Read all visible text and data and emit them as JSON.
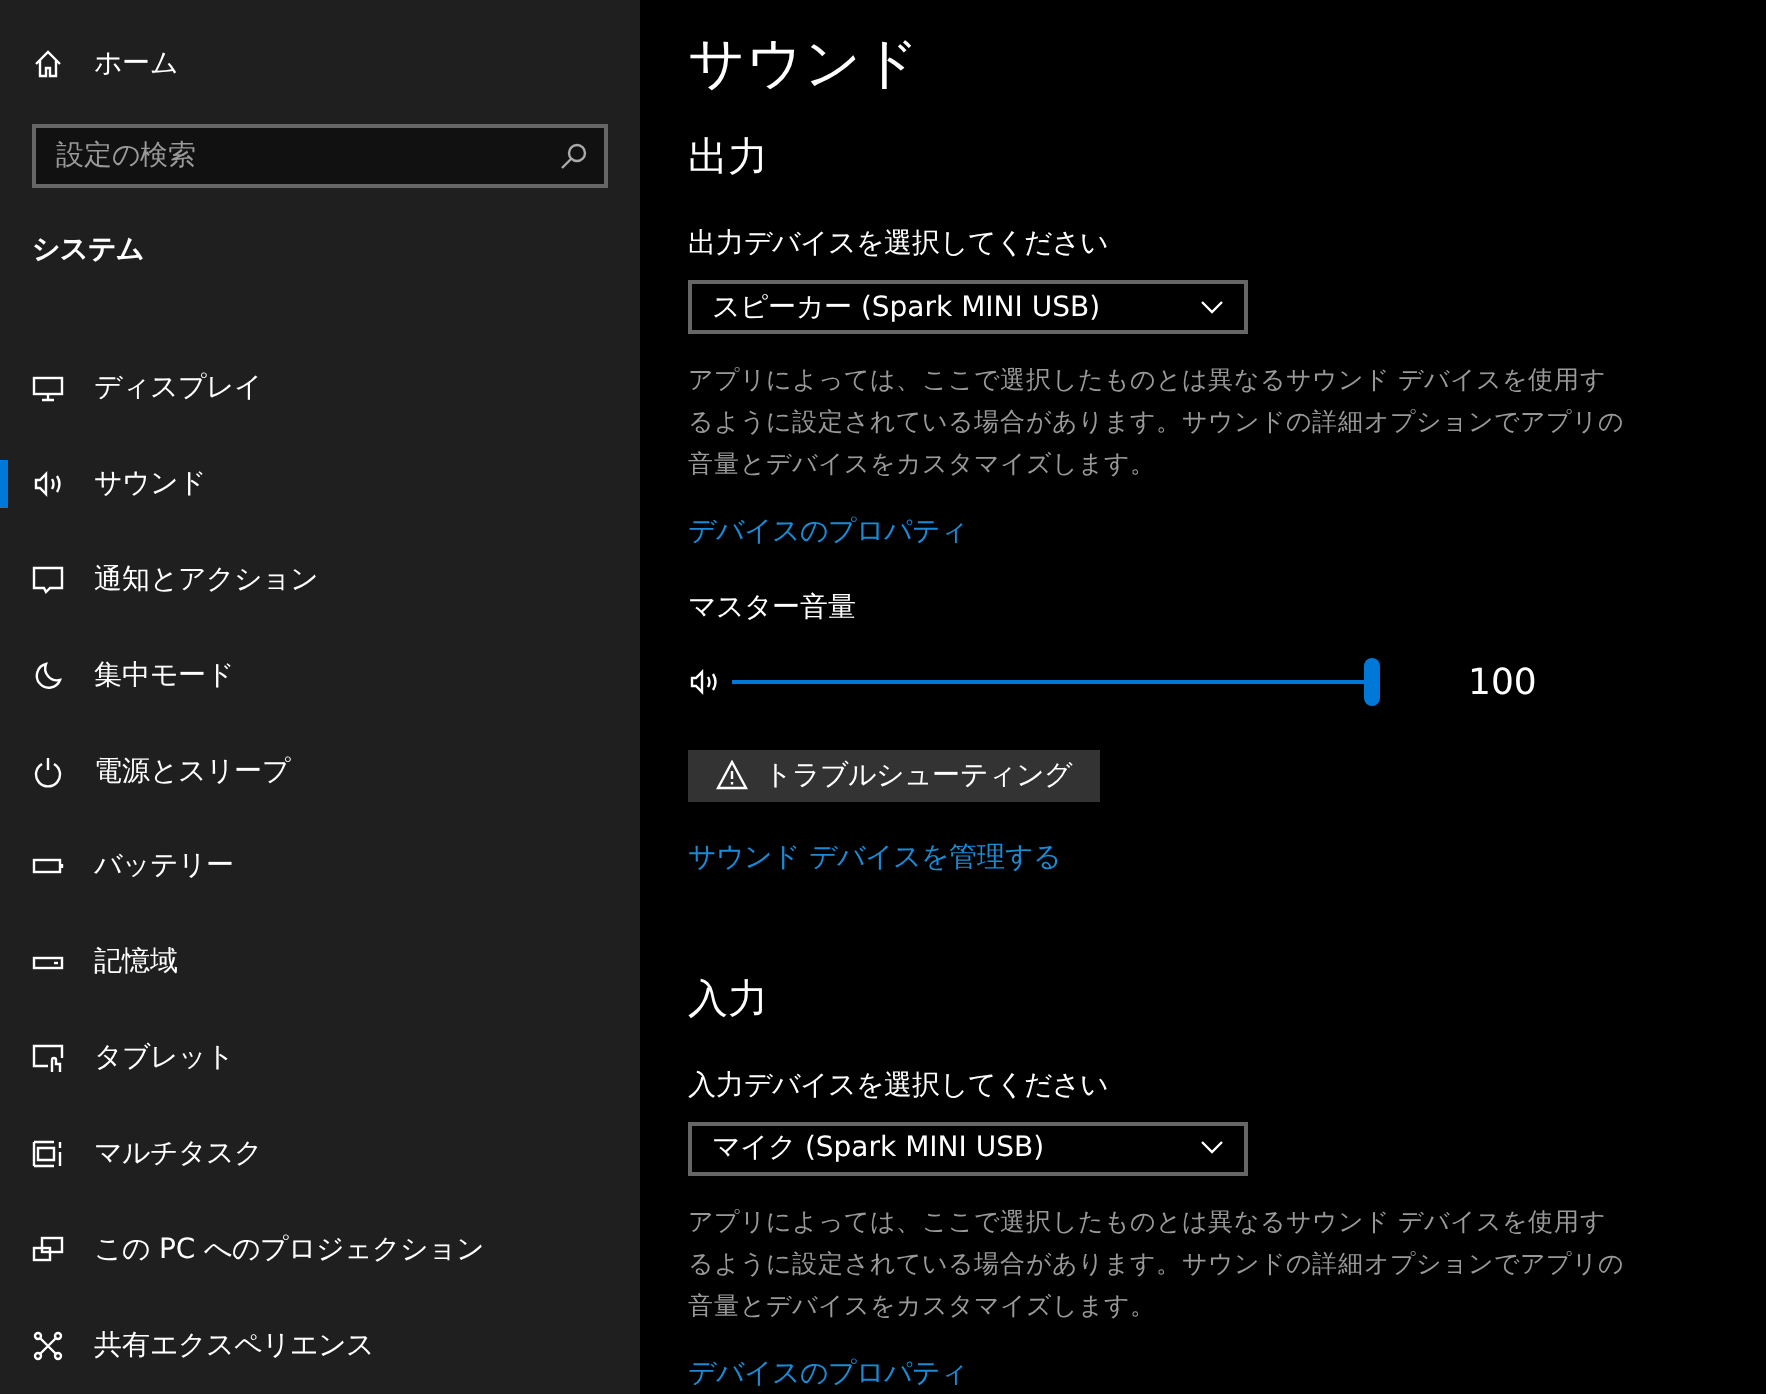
{
  "sidebar": {
    "home": {
      "label": "ホーム"
    },
    "search": {
      "placeholder": "設定の検索"
    },
    "section": "システム",
    "items": [
      {
        "kind": "display",
        "label": "ディスプレイ",
        "selected": false
      },
      {
        "kind": "sound",
        "label": "サウンド",
        "selected": true
      },
      {
        "kind": "notifications",
        "label": "通知とアクション",
        "selected": false
      },
      {
        "kind": "focus",
        "label": "集中モード",
        "selected": false
      },
      {
        "kind": "power",
        "label": "電源とスリープ",
        "selected": false
      },
      {
        "kind": "battery",
        "label": "バッテリー",
        "selected": false
      },
      {
        "kind": "storage",
        "label": "記憶域",
        "selected": false
      },
      {
        "kind": "tablet",
        "label": "タブレット",
        "selected": false
      },
      {
        "kind": "multitask",
        "label": "マルチタスク",
        "selected": false
      },
      {
        "kind": "project",
        "label": "この PC へのプロジェクション",
        "selected": false
      },
      {
        "kind": "shared",
        "label": "共有エクスペリエンス",
        "selected": false
      }
    ]
  },
  "page": {
    "title": "サウンド",
    "output": {
      "heading": "出力",
      "device_label": "出力デバイスを選択してください",
      "device": "スピーカー (Spark MINI USB)",
      "description": "アプリによっては、ここで選択したものとは異なるサウンド デバイスを使用するように設定されている場合があります。サウンドの詳細オプションでアプリの音量とデバイスをカスタマイズします。",
      "properties_link": "デバイスのプロパティ",
      "volume_label": "マスター音量",
      "volume": {
        "level": 1.0,
        "reading": "100"
      },
      "troubleshoot_button": "トラブルシューティング",
      "manage_link": "サウンド デバイスを管理する"
    },
    "input": {
      "heading": "入力",
      "device_label": "入力デバイスを選択してください",
      "device": "マイク (Spark MINI USB)",
      "description": "アプリによっては、ここで選択したものとは異なるサウンド デバイスを使用するように設定されている場合があります。サウンドの詳細オプションでアプリの音量とデバイスをカスタマイズします。",
      "properties_link": "デバイスのプロパティ"
    }
  }
}
